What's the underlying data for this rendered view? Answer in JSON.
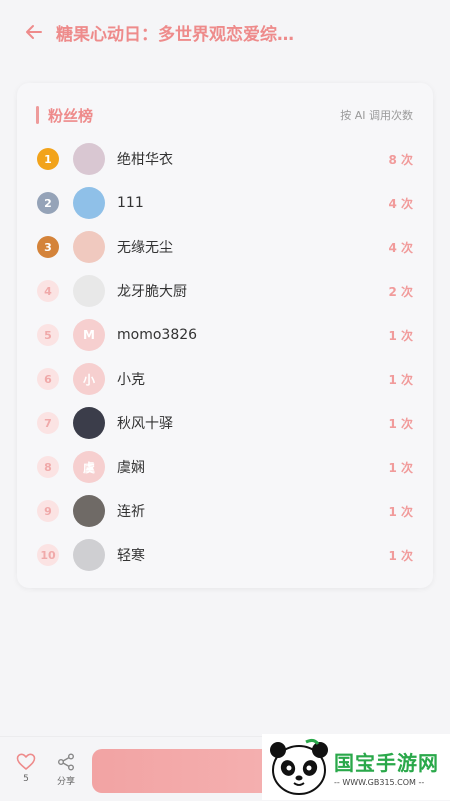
{
  "header": {
    "title": "糖果心动日：多世界观恋爱综…"
  },
  "card": {
    "title": "粉丝榜",
    "note": "按 AI 调用次数",
    "rows": [
      {
        "rank": "1",
        "name": "绝柑华衣",
        "count": "8 次",
        "avatar_text": "",
        "avatar_color": "#d9c7d2"
      },
      {
        "rank": "2",
        "name": "111",
        "count": "4 次",
        "avatar_text": "",
        "avatar_color": "#8fc0e8"
      },
      {
        "rank": "3",
        "name": "无缘无尘",
        "count": "4 次",
        "avatar_text": "",
        "avatar_color": "#f0c9bf"
      },
      {
        "rank": "4",
        "name": "龙牙脆大厨",
        "count": "2 次",
        "avatar_text": "",
        "avatar_color": "#e8e8e8"
      },
      {
        "rank": "5",
        "name": "momo3826",
        "count": "1 次",
        "avatar_text": "M",
        "avatar_color": "#f6cfcf"
      },
      {
        "rank": "6",
        "name": "小克",
        "count": "1 次",
        "avatar_text": "小",
        "avatar_color": "#f6cfcf"
      },
      {
        "rank": "7",
        "name": "秋风十驿",
        "count": "1 次",
        "avatar_text": "",
        "avatar_color": "#3b3d4a"
      },
      {
        "rank": "8",
        "name": "虞娴",
        "count": "1 次",
        "avatar_text": "虞",
        "avatar_color": "#f6cfcf"
      },
      {
        "rank": "9",
        "name": "连祈",
        "count": "1 次",
        "avatar_text": "",
        "avatar_color": "#6f6a66"
      },
      {
        "rank": "10",
        "name": "轻寒",
        "count": "1 次",
        "avatar_text": "",
        "avatar_color": "#cfcfd2"
      }
    ]
  },
  "bottom": {
    "like_count": "5",
    "share_label": "分享"
  },
  "watermark": {
    "name": "国宝手游网",
    "url": "-- WWW.GB315.COM --"
  },
  "colors": {
    "accent": "#ee8b8b",
    "gold": "#f2a31b",
    "silver": "#95a3b8",
    "bronze": "#d4833a"
  }
}
